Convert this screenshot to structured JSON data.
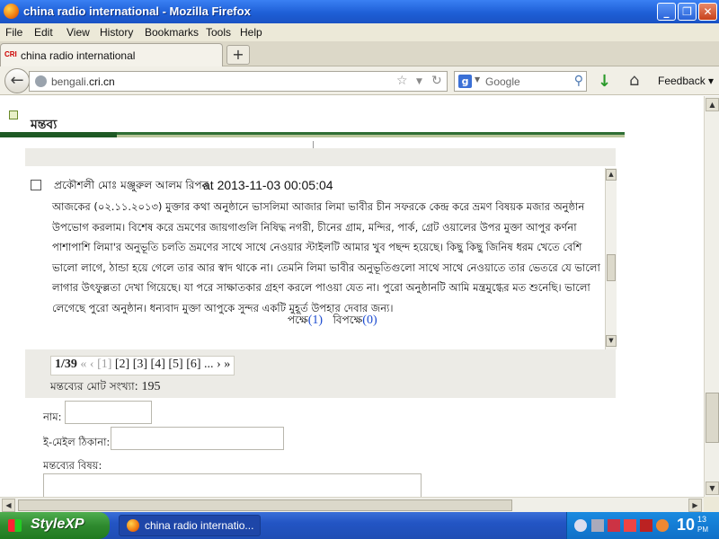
{
  "window": {
    "title": "china radio international - Mozilla Firefox",
    "controls": {
      "minimize": "_",
      "maximize": "❐",
      "close": "✕"
    }
  },
  "menu": [
    "File",
    "Edit",
    "View",
    "History",
    "Bookmarks",
    "Tools",
    "Help"
  ],
  "tab": {
    "logo": "CRI",
    "label": "china radio international",
    "new_tab": "+"
  },
  "nav": {
    "url_prefix": "bengali.",
    "url_domain": "cri.cn",
    "search_placeholder": "Google",
    "feedback": "Feedback",
    "icons": [
      "back-icon",
      "globe-icon",
      "star-icon",
      "dropdown-icon",
      "reload-icon",
      "google-icon",
      "search-icon",
      "download-icon",
      "home-icon"
    ]
  },
  "page": {
    "section_title": "মন্তব্য",
    "comment": {
      "author": "প্রকৌশলী মোঃ মঞ্জুরুল আলম রিপন",
      "at": "at",
      "timestamp": "2013-11-03 00:05:04",
      "body": "আজকের (০২.১১.২০১৩) মুক্তার কথা অনুষ্ঠানে ভাসলিমা আজার লিমা ভাবীর চীন সফরকে কেন্দ্র করে ভ্রমণ বিষয়ক মজার অনুষ্ঠান উপভোগ করলাম। বিশেষ করে ভ্রমণের জায়গাগুলি নিষিদ্ধ নগরী, চীনের গ্রাম, মন্দির, পার্ক, গ্রেট ওয়ালের উপর মুক্তা আপুর কর্ণনা পাশাপাশি লিমা'র অনুভূতি চলতি ভ্রমণের সাথে সাথে নেওয়ার স্টাইলটি আমার খুব পছন্দ হয়েছে। কিছু কিছু জিনিষ ধরম খেতে বেশি ভালো লাগে, ঠান্ডা হয়ে গেলে তার আর স্বাদ থাকে না। তেমনি লিমা ভাবীর অনুভূতিগুলো সাথে সাথে নেওয়াতে তার ভেতরে যে ভালো লাগার উৎফুল্লতা দেখা গিয়েছে। যা পরে সাক্ষাতকার গ্রহণ করলে পাওয়া যেত না। পুরো অনুষ্ঠানটি আমি মন্ত্রমুগ্ধের মত শুনেছি। ভালো লেগেছে পুরো অনুষ্ঠান। ধন্যবাদ মুক্তা আপুকে সুন্দর একটি মুহূর্ত উপহার দেবার জন্য।",
      "votes_for_label": "পক্ষে",
      "votes_for": "(1)",
      "votes_against_label": "বিপক্ষে",
      "votes_against": "(0)"
    },
    "pager": {
      "current": "1/39",
      "prev": "« ‹",
      "pages": [
        "[1]",
        "[2]",
        "[3]",
        "[4]",
        "[5]",
        "[6]"
      ],
      "ellipsis": "...",
      "next": "› »"
    },
    "total_label": "মন্তব্যের মোট সংখ্যা:",
    "total_count": "195",
    "form": {
      "name_label": "নাম:",
      "email_label": "ই-মেইল ঠিকানা:",
      "subject_label": "মন্তব্যের বিষয়:"
    }
  },
  "taskbar": {
    "start_label": "StyleXP",
    "task_label": "china radio internatio...",
    "clock": "10",
    "clock_min": "13",
    "clock_ampm": "PM"
  }
}
